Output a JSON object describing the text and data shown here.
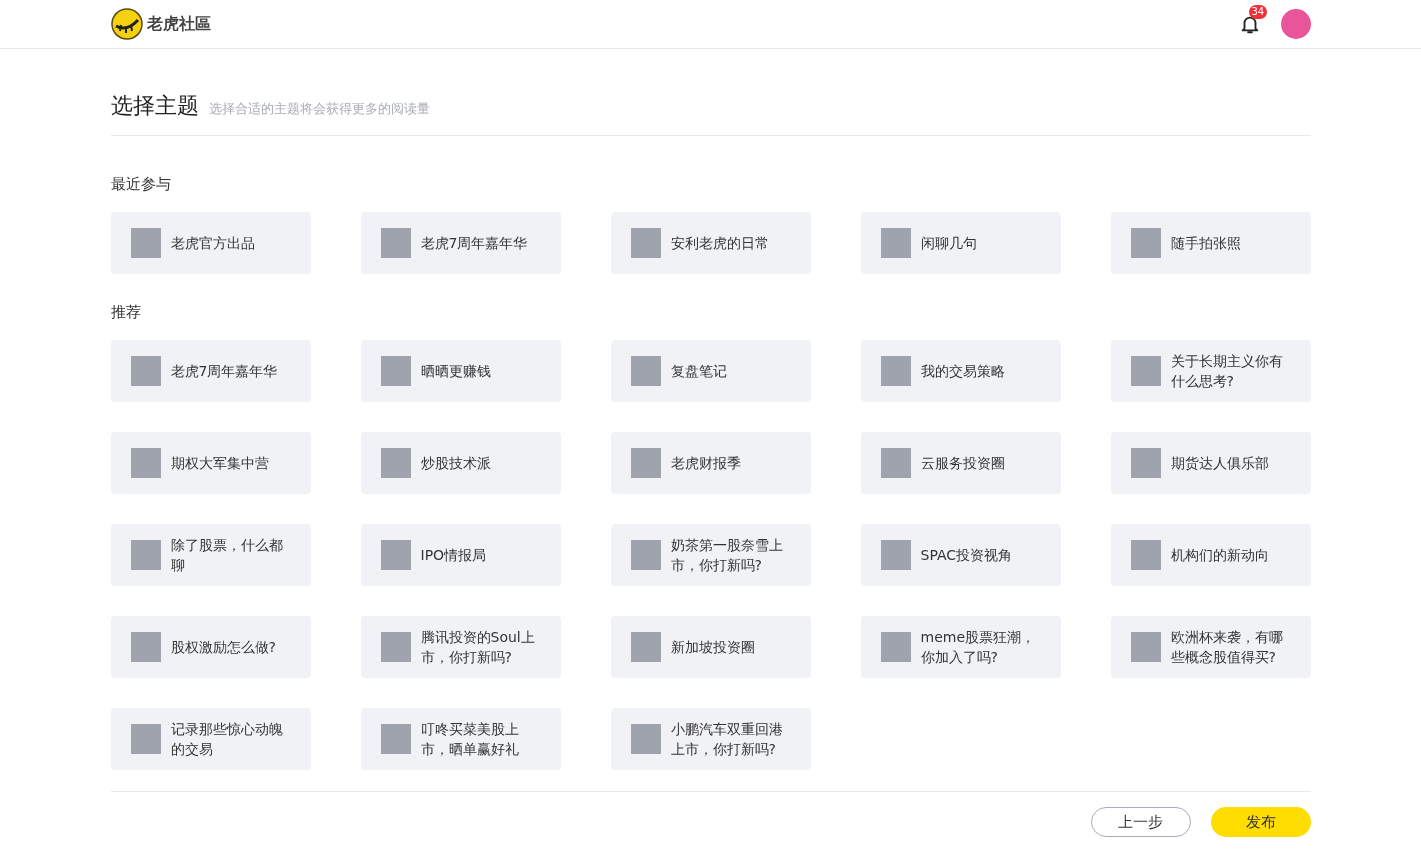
{
  "header": {
    "logo_text": "老虎社區",
    "notification_count": "34"
  },
  "page": {
    "title": "选择主题",
    "subtitle": "选择合适的主题将会获得更多的阅读量"
  },
  "sections": [
    {
      "title": "最近参与",
      "topics": [
        {
          "name": "老虎官方出品"
        },
        {
          "name": "老虎7周年嘉年华"
        },
        {
          "name": "安利老虎的日常"
        },
        {
          "name": "闲聊几句"
        },
        {
          "name": "随手拍张照"
        }
      ]
    },
    {
      "title": "推荐",
      "topics": [
        {
          "name": "老虎7周年嘉年华"
        },
        {
          "name": "晒晒更赚钱"
        },
        {
          "name": "复盘笔记"
        },
        {
          "name": "我的交易策略"
        },
        {
          "name": "关于长期主义你有什么思考?"
        },
        {
          "name": "期权大军集中营"
        },
        {
          "name": "炒股技术派"
        },
        {
          "name": "老虎财报季"
        },
        {
          "name": "云服务投资圈"
        },
        {
          "name": "期货达人俱乐部"
        },
        {
          "name": "除了股票，什么都聊"
        },
        {
          "name": "IPO情报局"
        },
        {
          "name": "奶茶第一股奈雪上市，你打新吗?"
        },
        {
          "name": "SPAC投资视角"
        },
        {
          "name": "机构们的新动向"
        },
        {
          "name": "股权激励怎么做?"
        },
        {
          "name": "腾讯投资的Soul上市，你打新吗?"
        },
        {
          "name": "新加坡投资圈"
        },
        {
          "name": "meme股票狂潮，你加入了吗?"
        },
        {
          "name": "欧洲杯来袭，有哪些概念股值得买?"
        },
        {
          "name": "记录那些惊心动魄的交易"
        },
        {
          "name": "叮咚买菜美股上市，晒单赢好礼"
        },
        {
          "name": "小鹏汽车双重回港上市，你打新吗?"
        }
      ]
    }
  ],
  "buttons": {
    "back": "上一步",
    "publish": "发布"
  }
}
